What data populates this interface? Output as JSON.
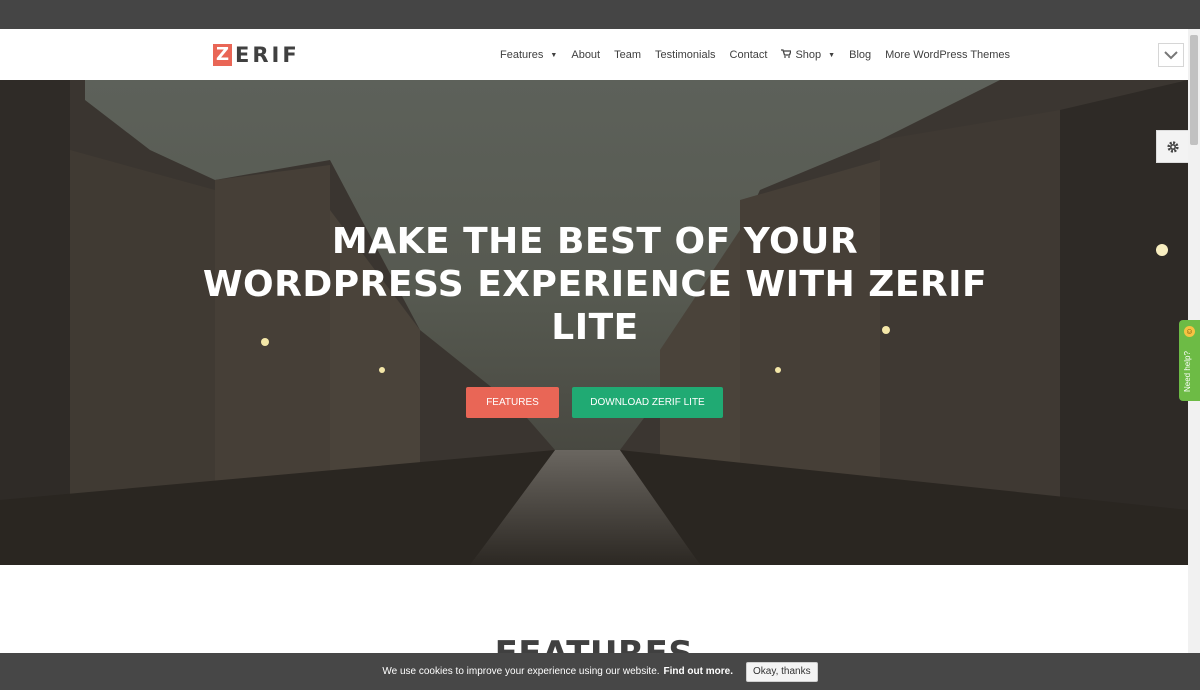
{
  "logo": {
    "initial": "Z",
    "rest": "ERIF",
    "accent_color": "#e96656"
  },
  "nav": {
    "items": [
      {
        "label": "Features",
        "has_dropdown": true
      },
      {
        "label": "About"
      },
      {
        "label": "Team"
      },
      {
        "label": "Testimonials"
      },
      {
        "label": "Contact"
      },
      {
        "label": "Shop",
        "has_dropdown": true,
        "icon": "cart-icon"
      },
      {
        "label": "Blog"
      },
      {
        "label": "More WordPress Themes"
      }
    ]
  },
  "hero": {
    "title": "MAKE THE BEST OF YOUR WORDPRESS EXPERIENCE WITH ZERIF LITE",
    "buttons": [
      {
        "label": "FEATURES",
        "color": "#e96656"
      },
      {
        "label": "DOWNLOAD ZERIF LITE",
        "color": "#20aa73"
      }
    ]
  },
  "section": {
    "title": "FEATURES"
  },
  "help_tab": {
    "label": "Need help?",
    "color": "#6dbb45"
  },
  "cookie": {
    "text": "We use cookies to improve your experience using our website.",
    "link": "Find out more.",
    "button": "Okay, thanks"
  },
  "icons": {
    "collapse": "chevron-down-icon",
    "settings": "gear-icon"
  }
}
